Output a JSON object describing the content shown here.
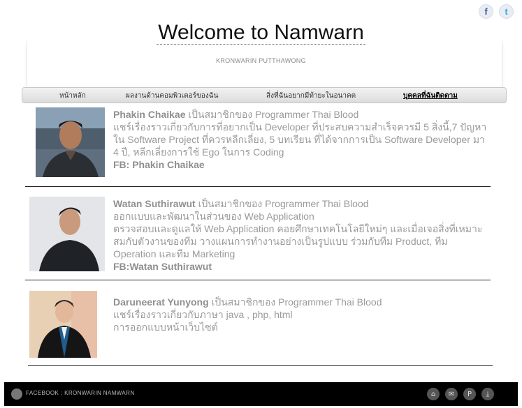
{
  "social": {
    "facebook_glyph": "f",
    "twitter_glyph": "t"
  },
  "header": {
    "title": "Welcome to Namwarn",
    "subtitle": "KRONWARIN PUTTHAWONG"
  },
  "nav": {
    "items": [
      {
        "label": "หน้าหลัก"
      },
      {
        "label": "ผลงานด้านคอมพิวเตอร์ของฉัน"
      },
      {
        "label": "สิ่งที่ฉันอยากมีท้ายะในอนาคต"
      },
      {
        "label": "บุคคลที่ฉันติดตาม",
        "active": true
      }
    ]
  },
  "members": [
    {
      "name": "Phakin Chaikae",
      "member_of": " เป็นสมาชิกของ Programmer Thai Blood",
      "lines": [
        " แชร์เรื่องราวเกี่ยวกับการที่อยากเป็น Developer ที่ประสบความสำเร็จควรมี 5 สิ่งนี้,7 ปัญหาใน Software Project ที่ควรหลีกเลี่ยง, 5 บทเรียน ที่ได้จากการเป็น Software Developer มา 4 ปี, หลีกเลี่ยงการใช้ Ego ในการ Coding"
      ],
      "fb": "FB: Phakin Chaikae"
    },
    {
      "name": "Watan Suthirawut",
      "member_of": "  เป็นสมาชิกของ Programmer Thai Blood",
      "lines": [
        "ออกแบบและพัฒนาในส่วนของ Web Application",
        "ตรวจสอบและดูแลให้ Web Application คอยศึกษาเทคโนโลยีใหม่ๆ และเมื่อเจอสิ่งที่เหมาะสมกับตัวงานของทีม วางแผนการทำงานอย่างเป็นรูปแบบ ร่วมกับทีม Product, ทีม Operation และทีม Marketing"
      ],
      "fb": "FB:Watan Suthirawut"
    },
    {
      "name": "Daruneerat Yunyong",
      "member_of": " เป็นสมาชิกของ Programmer Thai Blood",
      "lines": [
        "แชร์เรื่องราวเกี่ยวกับภาษา java , php, html",
        "การออกแบบหน้าเว็บไซต์"
      ],
      "fb": ""
    }
  ],
  "footer": {
    "text": "FACEBOOK : KRONWARIN NAMWARN",
    "icons": [
      "home-icon",
      "mail-icon",
      "pinterest-icon",
      "download-icon"
    ]
  }
}
